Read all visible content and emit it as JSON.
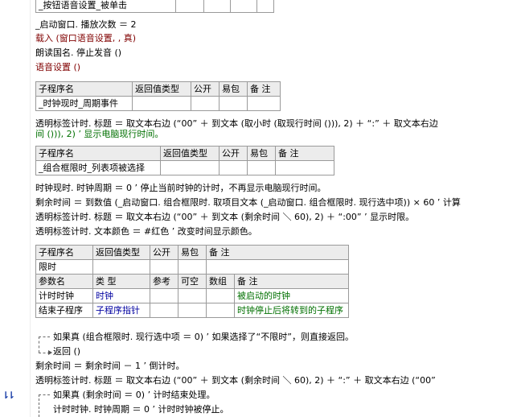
{
  "top_table": {
    "name": "_按钮语音设置_被单击"
  },
  "lines_a": [
    "_启动窗口. 播放次数 ＝ 2",
    "载入 (窗口语音设置, , 真)",
    "朗读国名. 停止发音 ()",
    "语音设置 ()"
  ],
  "table1": {
    "headers": [
      "子程序名",
      "返回值类型",
      "公开",
      "易包",
      "备 注"
    ],
    "row": [
      "_时钟现时_周期事件",
      "",
      "",
      "",
      ""
    ]
  },
  "lines_b": [
    "透明标签计时. 标题 ＝ 取文本右边 (“00” ＋ 到文本 (取小时 (取现行时间 ())), 2) ＋ “:” ＋ 取文本右边",
    "间 ())), 2) ’ 显示电脑现行时间。"
  ],
  "table2": {
    "headers": [
      "子程序名",
      "返回值类型",
      "公开",
      "易包",
      "备 注"
    ],
    "row": [
      "_组合框限时_列表项被选择",
      "",
      "",
      "",
      ""
    ]
  },
  "lines_c": [
    "时钟现时. 时钟周期 ＝ 0 ’ 停止当前时钟的计时，不再显示电脑现行时间。",
    "剩余时间 ＝ 到数值 (_启动窗口. 组合框限时. 取项目文本 (_启动窗口. 组合框限时. 现行选中项)) × 60 ’ 计算",
    "透明标签计时. 标题 ＝ 取文本右边 (“00” ＋ 到文本 (剩余时间 ＼ 60), 2) ＋ “:00” ’ 显示时限。",
    "透明标签计时. 文本颜色 ＝ #红色 ’ 改变时间显示颜色。"
  ],
  "table3": {
    "headers": [
      "子程序名",
      "返回值类型",
      "公开",
      "易包",
      "备 注"
    ],
    "name_row": "限时",
    "param_headers": [
      "参数名",
      "类 型",
      "参考",
      "可空",
      "数组",
      "备 注"
    ],
    "params": [
      [
        "计时时钟",
        "时钟",
        "",
        "",
        "",
        "被启动的时钟"
      ],
      [
        "结束子程序",
        "子程序指针",
        "",
        "",
        "",
        "时钟停止后将转到的子程序"
      ]
    ]
  },
  "lines_d": [
    "如果真 (组合框限时. 现行选中项 ＝ 0) ’ 如果选择了“不限时”，则直接返回。",
    "返回 ()",
    "剩余时间 ＝ 剩余时间 － 1 ’ 倒计时。",
    "透明标签计时. 标题 ＝ 取文本右边 (“00” ＋ 到文本 (剩余时间 ＼ 60), 2) ＋ “:” ＋ 取文本右边 (“00”",
    "如果真 (剩余时间 ＝ 0) ’ 计时结束处理。",
    "计时时钟. 时钟周期 ＝ 0 ’ 计时时钟被停止。"
  ],
  "gutter_icon": "breakpoint-arrows-icon"
}
